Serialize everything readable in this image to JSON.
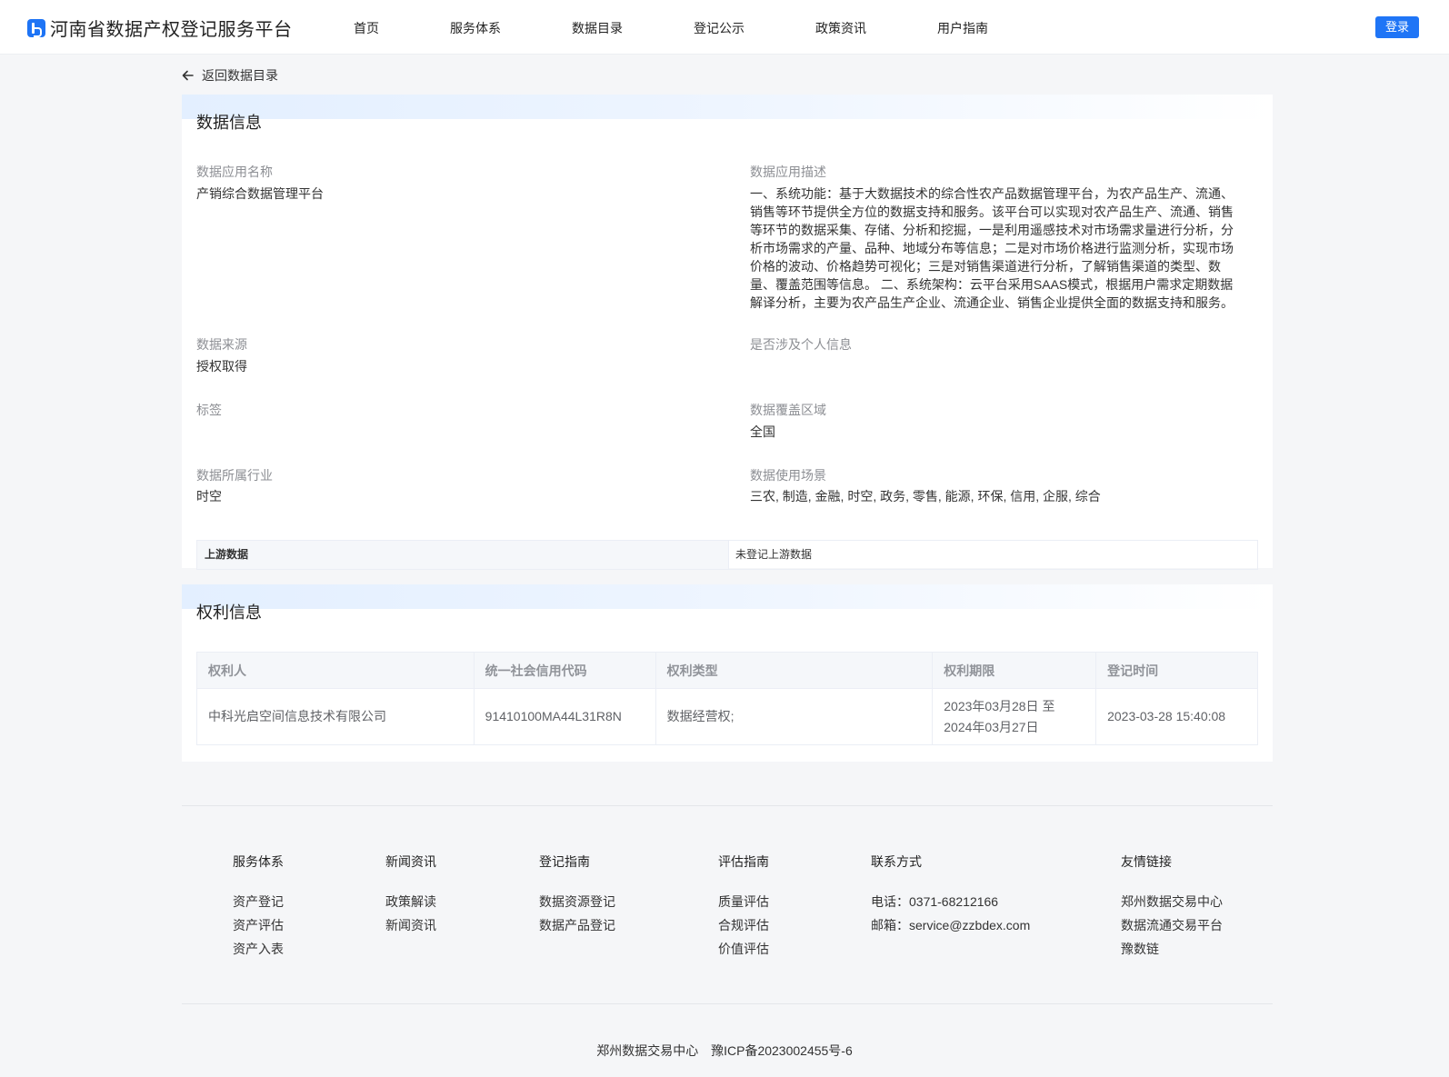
{
  "header": {
    "logo_text": "河南省数据产权登记服务平台",
    "nav": [
      "首页",
      "服务体系",
      "数据目录",
      "登记公示",
      "政策资讯",
      "用户指南"
    ],
    "login_label": "登录",
    "accent_color": "#1f75f6"
  },
  "back_link": "返回数据目录",
  "data_info": {
    "title": "数据信息",
    "app_name_label": "数据应用名称",
    "app_name": "产销综合数据管理平台",
    "desc_label": "数据应用描述",
    "desc": "一、系统功能：基于大数据技术的综合性农产品数据管理平台，为农产品生产、流通、销售等环节提供全方位的数据支持和服务。该平台可以实现对农产品生产、流通、销售等环节的数据采集、存储、分析和挖掘，一是利用遥感技术对市场需求量进行分析，分析市场需求的产量、品种、地域分布等信息；二是对市场价格进行监测分析，实现市场价格的波动、价格趋势可视化；三是对销售渠道进行分析，了解销售渠道的类型、数量、覆盖范围等信息。 二、系统架构：云平台采用SAAS模式，根据用户需求定期数据解译分析，主要为农产品生产企业、流通企业、销售企业提供全面的数据支持和服务。",
    "source_label": "数据来源",
    "source": "授权取得",
    "personal_label": "是否涉及个人信息",
    "personal": "",
    "tags_label": "标签",
    "tags": "",
    "coverage_label": "数据覆盖区域",
    "coverage": "全国",
    "industry_label": "数据所属行业",
    "industry": "时空",
    "scene_label": "数据使用场景",
    "scene": "三农, 制造, 金融, 时空, 政务, 零售, 能源, 环保, 信用, 企服, 综合",
    "upstream_label": "上游数据",
    "upstream_value": "未登记上游数据"
  },
  "rights_info": {
    "title": "权利信息",
    "columns": [
      "权利人",
      "统一社会信用代码",
      "权利类型",
      "权利期限",
      "登记时间"
    ],
    "rows": [
      {
        "holder": "中科光启空间信息技术有限公司",
        "credit_code": "91410100MA44L31R8N",
        "right_type": "数据经营权;",
        "period_start": "2023年03月28日 至",
        "period_end": "2024年03月27日",
        "reg_time": "2023-03-28 15:40:08"
      }
    ]
  },
  "footer": {
    "cols": [
      {
        "heading": "服务体系",
        "items": [
          "资产登记",
          "资产评估",
          "资产入表"
        ]
      },
      {
        "heading": "新闻资讯",
        "items": [
          "政策解读",
          "新闻资讯"
        ]
      },
      {
        "heading": "登记指南",
        "items": [
          "数据资源登记",
          "数据产品登记"
        ]
      },
      {
        "heading": "评估指南",
        "items": [
          "质量评估",
          "合规评估",
          "价值评估"
        ]
      },
      {
        "heading": "联系方式",
        "items": [
          "电话：0371-68212166",
          "邮箱：service@zzbdex.com"
        ]
      },
      {
        "heading": "友情链接",
        "items": [
          "郑州数据交易中心",
          "数据流通交易平台",
          "豫数链"
        ]
      }
    ],
    "copyright_org": "郑州数据交易中心",
    "icp": "豫ICP备2023002455号-6"
  }
}
